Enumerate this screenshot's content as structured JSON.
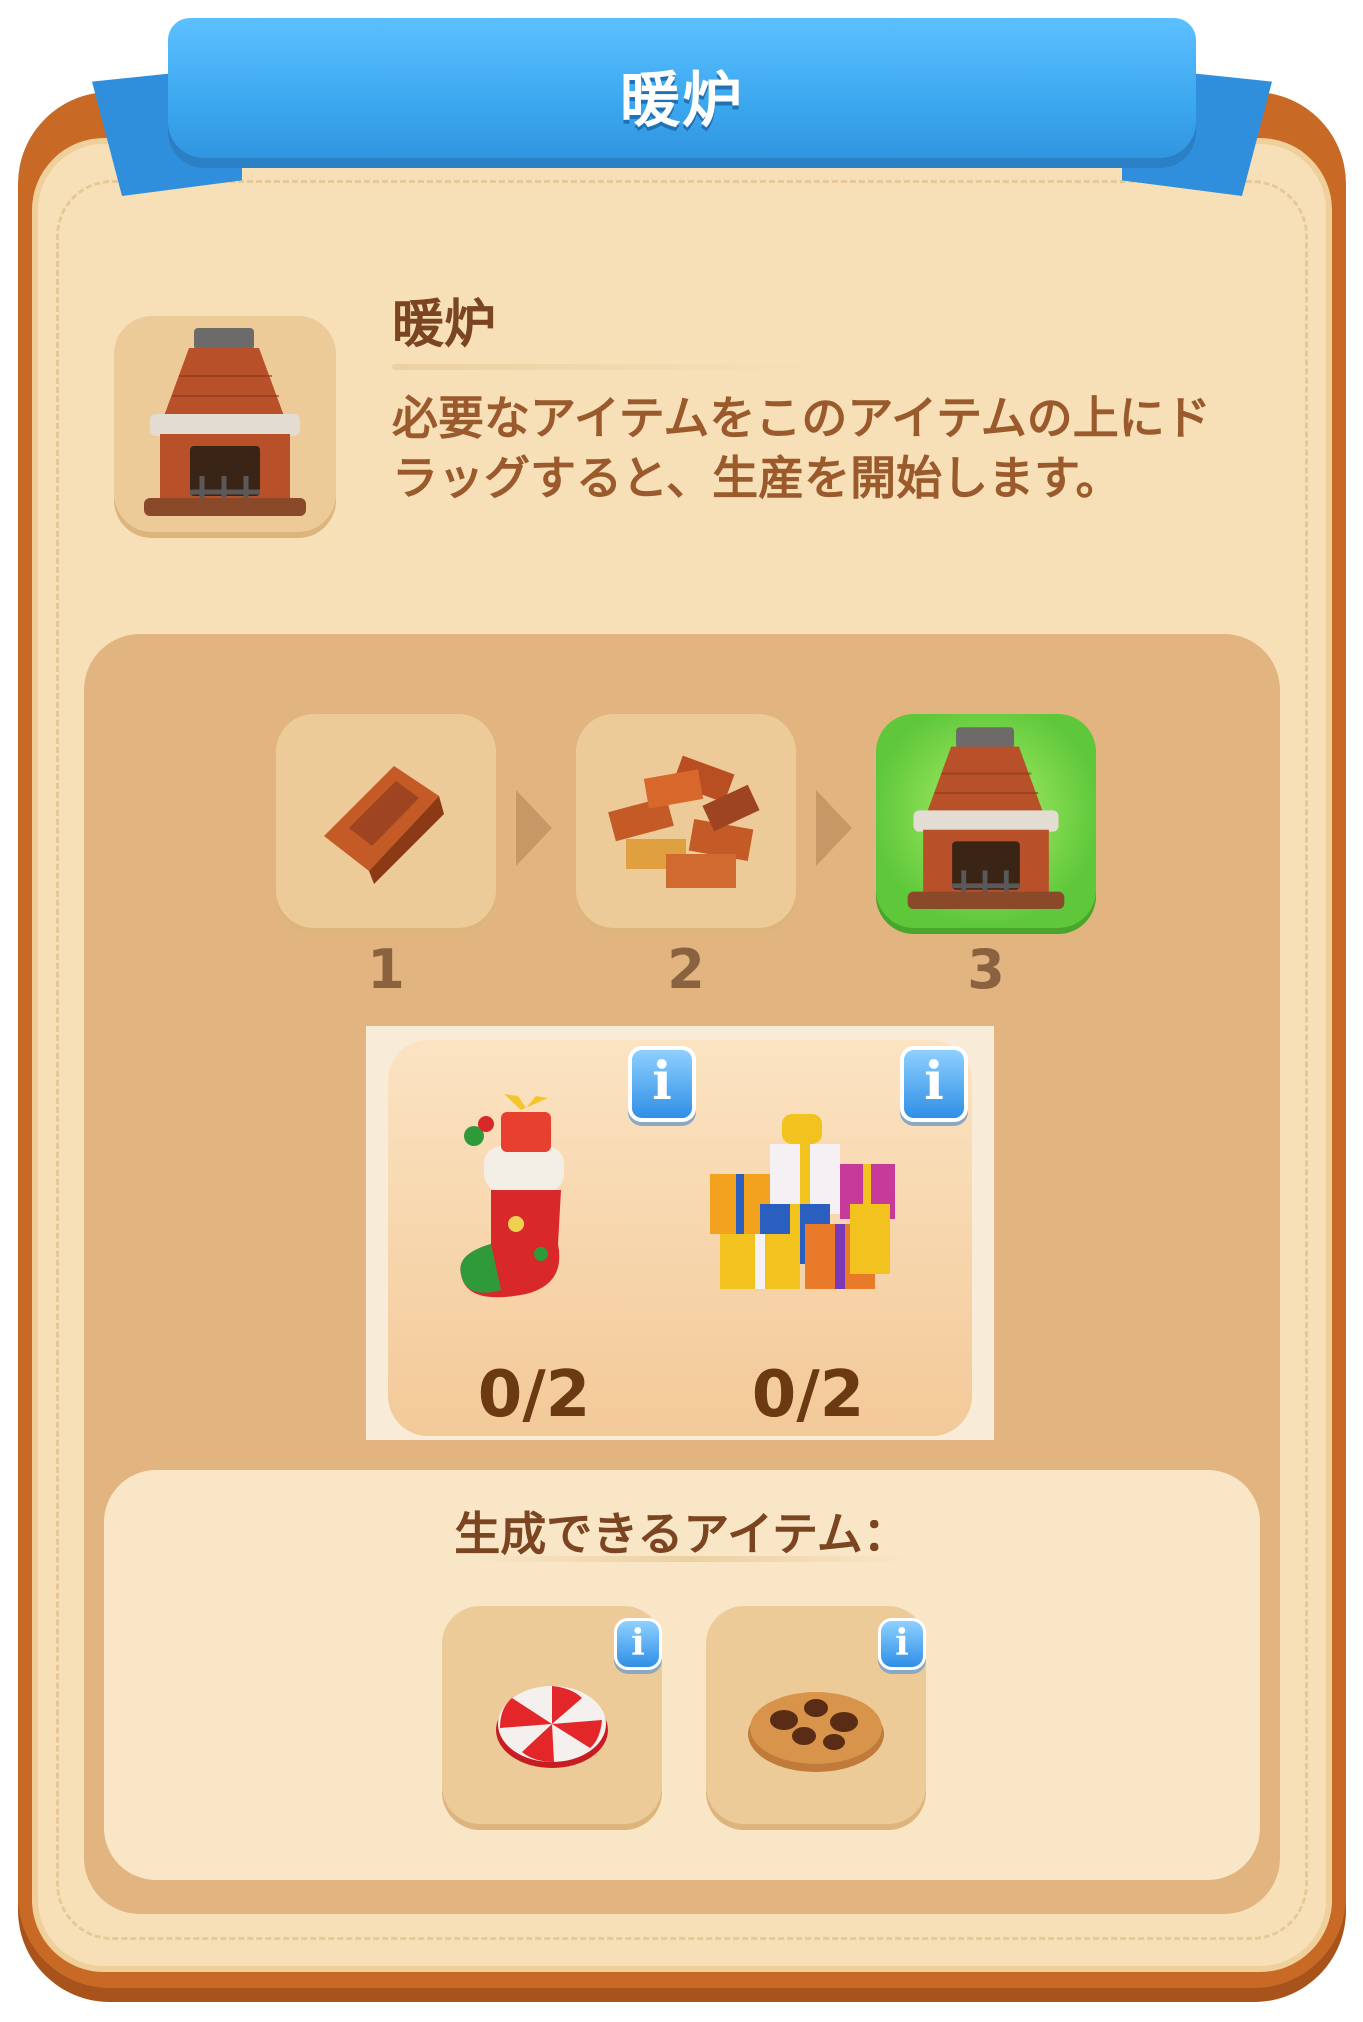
{
  "header": {
    "title": "暖炉"
  },
  "item": {
    "name": "暖炉",
    "icon": "fireplace-icon",
    "description_line1": "必要なアイテムをこのアイテムの上にド",
    "description_line2": "ラッグすると、生産を開始します。"
  },
  "stages": [
    {
      "level": "1",
      "icon": "brick-icon"
    },
    {
      "level": "2",
      "icon": "brick-pile-icon"
    },
    {
      "level": "3",
      "icon": "fireplace-icon",
      "active": true
    }
  ],
  "requirements": [
    {
      "icon": "christmas-stocking-icon",
      "progress": "0/2"
    },
    {
      "icon": "gift-boxes-icon",
      "progress": "0/2"
    }
  ],
  "generates": {
    "title": "生成できるアイテム：",
    "items": [
      {
        "icon": "peppermint-candy-icon"
      },
      {
        "icon": "chocolate-cookie-icon"
      }
    ]
  },
  "colors": {
    "frame": "#c86a26",
    "panel": "#f7e0b8",
    "ribbon": "#3aa6ee",
    "active_stage": "#5ec73a",
    "text_brown": "#7a4520"
  }
}
